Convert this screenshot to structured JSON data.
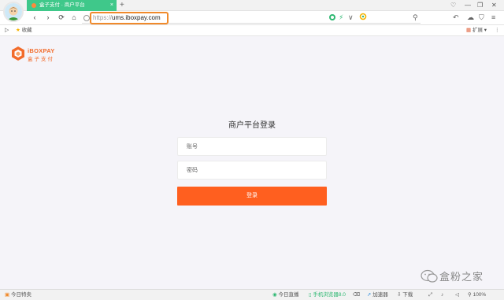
{
  "browser": {
    "tab_title": "盒子支付 · 商户平台",
    "url_scheme": "https://",
    "url_host": "ums.iboxpay.com",
    "window_controls": [
      "♡",
      "—",
      "❐",
      "✕"
    ],
    "tab_add": "+"
  },
  "nav": {
    "back": "‹",
    "forward": "›",
    "refresh": "⟳",
    "home": "⌂",
    "bolt": "⚡",
    "dropdown": "∨",
    "search": "⚲",
    "undo": "↶",
    "cloud": "☁",
    "shield": "⛉",
    "menu": "≡"
  },
  "bookmarks": {
    "toggle": "▷",
    "star": "★",
    "favorites": "收藏",
    "extensions": "扩展",
    "ext_arrow": "▾",
    "more": "⋮"
  },
  "page": {
    "logo_en": "iBOXPAY",
    "logo_cn": "盒子支付",
    "login_title": "商户平台登录",
    "account_placeholder": "账号",
    "password_placeholder": "密码",
    "login_button": "登录"
  },
  "watermark": {
    "text": "盒粉之家"
  },
  "statusbar": {
    "left": "今日特卖",
    "today_live": "今日直播",
    "browser_version": "手机浏览器8.0",
    "accelerator": "加速器",
    "download": "下载",
    "zoom": "100%"
  },
  "colors": {
    "accent": "#ff5f1f",
    "tab": "#3fc88a",
    "url_highlight": "#f08a2b"
  }
}
